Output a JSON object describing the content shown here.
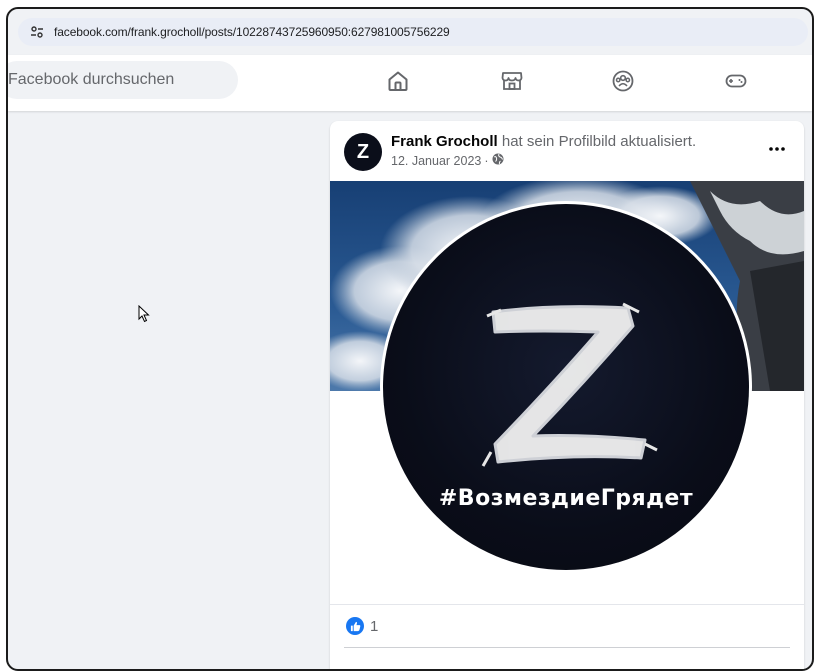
{
  "browser": {
    "url": "facebook.com/frank.grocholl/posts/10228743725960950:627981005756229"
  },
  "fb_nav": {
    "search_placeholder": "Facebook durchsuchen",
    "icons": [
      "home-icon",
      "marketplace-icon",
      "groups-icon",
      "gaming-icon"
    ]
  },
  "post": {
    "avatar_letter": "Z",
    "author": "Frank Grocholl",
    "action": "hat sein Profilbild aktualisiert.",
    "date": "12. Januar 2023",
    "separator": "·",
    "audience_icon": "globe-icon",
    "more_label": "•••",
    "image_letter": "Z",
    "image_hashtag": "#ВозмездиеГрядет",
    "reaction_count": "1"
  },
  "colors": {
    "brand": "#1877f2",
    "page_bg": "#f0f2f5",
    "text_primary": "#050505",
    "text_secondary": "#65676b"
  }
}
